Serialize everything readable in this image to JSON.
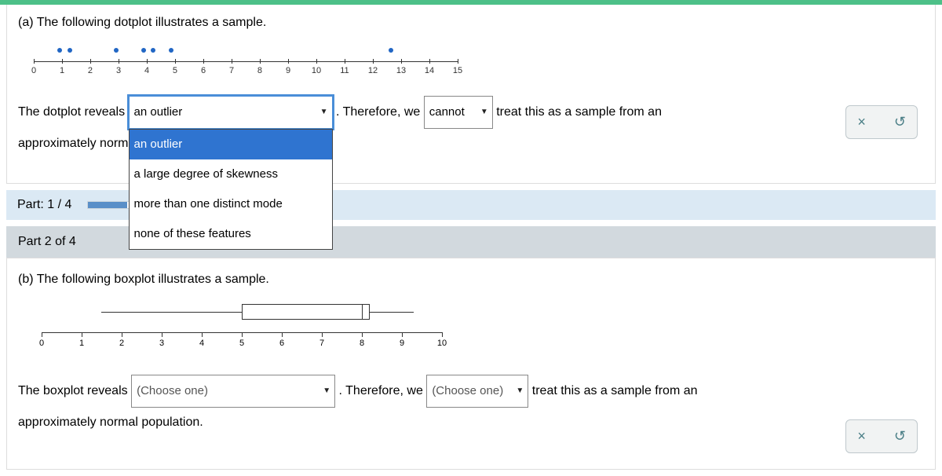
{
  "partA": {
    "question": "(a) The following dotplot illustrates a sample.",
    "sentence_1": "The dotplot reveals",
    "sentence_2": ". Therefore, we",
    "sentence_3": "treat this as a sample from an",
    "sentence_4": "approximately normal population.",
    "select1": {
      "value": "an outlier",
      "options": [
        "an outlier",
        "a large degree of skewness",
        "more than one distinct mode",
        "none of these features"
      ]
    },
    "select2": {
      "value": "cannot"
    }
  },
  "progress": {
    "label": "Part: 1 / 4"
  },
  "part2header": "Part 2 of 4",
  "partB": {
    "question": "(b) The following boxplot illustrates a sample.",
    "sentence_1": "The boxplot reveals",
    "sentence_2": ". Therefore, we",
    "sentence_3": "treat this as a sample from an",
    "sentence_4": "approximately normal population.",
    "select1_placeholder": "(Choose one)",
    "select2_placeholder": "(Choose one)"
  },
  "chart_data": [
    {
      "type": "dotplot",
      "x_ticks": [
        0,
        1,
        2,
        3,
        4,
        5,
        6,
        7,
        8,
        9,
        10,
        11,
        12,
        13,
        14,
        15
      ],
      "points": [
        1,
        1,
        3,
        4,
        4,
        5,
        13
      ]
    },
    {
      "type": "boxplot",
      "x_ticks": [
        0,
        1,
        2,
        3,
        4,
        5,
        6,
        7,
        8,
        9,
        10
      ],
      "min": 1.5,
      "q1": 5,
      "median": 8,
      "q3": 8.2,
      "max": 9.3
    }
  ],
  "actions": {
    "close": "×",
    "reset": "↺"
  }
}
